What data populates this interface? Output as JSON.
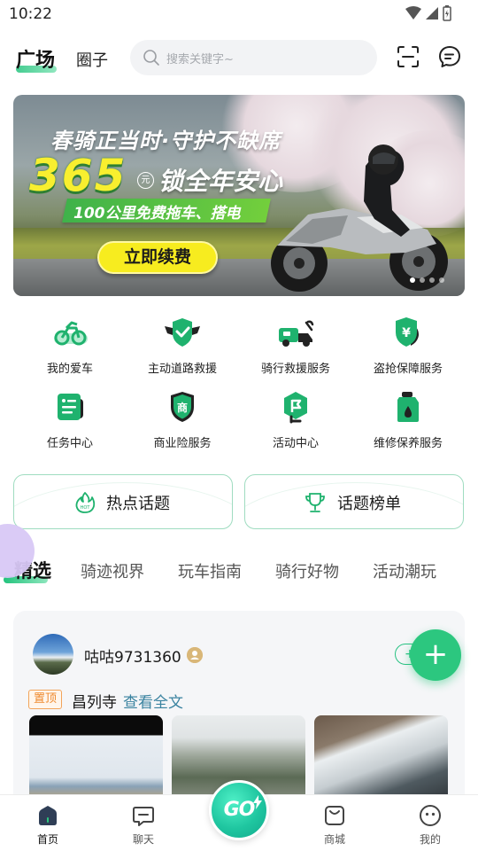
{
  "status_bar": {
    "time": "10:22"
  },
  "header": {
    "tabs": [
      {
        "label": "广场",
        "active": true
      },
      {
        "label": "圈子",
        "active": false
      }
    ],
    "search_placeholder": "搜索关键字~",
    "icons": [
      "scan-icon",
      "message-icon"
    ]
  },
  "banner": {
    "slogan": "春骑正当时·守护不缺席",
    "price": "365",
    "unit": "元",
    "headline": "锁全年安心",
    "ribbon": "100公里免费拖车、搭电",
    "cta": "立即续费",
    "slides": 4,
    "active_slide": 1
  },
  "quick_grid": [
    {
      "label": "我的爱车",
      "icon": "motorbike-icon"
    },
    {
      "label": "主动道路救援",
      "icon": "shield-wings-icon"
    },
    {
      "label": "骑行救援服务",
      "icon": "tow-truck-icon"
    },
    {
      "label": "盗抢保障服务",
      "icon": "yen-shield-icon"
    },
    {
      "label": "任务中心",
      "icon": "task-card-icon"
    },
    {
      "label": "商业险服务",
      "icon": "shang-shield-icon"
    },
    {
      "label": "活动中心",
      "icon": "flag-icon"
    },
    {
      "label": "维修保养服务",
      "icon": "oil-can-icon"
    }
  ],
  "topic_cards": [
    {
      "label": "热点话题",
      "icon": "hot-flame-icon"
    },
    {
      "label": "话题榜单",
      "icon": "trophy-icon"
    }
  ],
  "categories": [
    {
      "label": "精选",
      "active": true
    },
    {
      "label": "骑迹视界",
      "active": false
    },
    {
      "label": "玩车指南",
      "active": false
    },
    {
      "label": "骑行好物",
      "active": false
    },
    {
      "label": "活动潮玩",
      "active": false
    }
  ],
  "post": {
    "username": "咕咕9731360",
    "follow_label": "+",
    "pin_tag": "置顶",
    "title": "昌列寺",
    "read_more": "查看全文"
  },
  "fab_label": "+",
  "bottom_nav": [
    {
      "label": "首页",
      "icon": "home-icon",
      "active": true
    },
    {
      "label": "聊天",
      "icon": "chat-icon",
      "active": false
    },
    {
      "label": "GO",
      "icon": "go-icon",
      "active": false
    },
    {
      "label": "商城",
      "icon": "shop-bag-icon",
      "active": false
    },
    {
      "label": "我的",
      "icon": "profile-face-icon",
      "active": false
    }
  ],
  "colors": {
    "accent": "#2cc77f",
    "banner_cta": "#f7ec1f",
    "price_yellow": "#f8ef2f",
    "pin_orange": "#ef8a2e",
    "link_blue": "#3a83a0"
  }
}
